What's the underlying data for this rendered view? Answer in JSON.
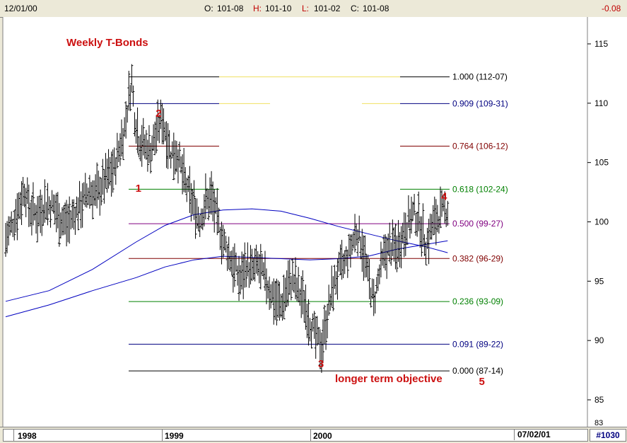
{
  "header": {
    "date": "12/01/00",
    "open_label": "O:",
    "open_value": "101-08",
    "high_label": "H:",
    "high_value": "101-10",
    "low_label": "L:",
    "low_value": "101-02",
    "close_label": "C:",
    "close_value": "101-08",
    "change": "-0.08"
  },
  "footer": {
    "years": [
      "1998",
      "1999",
      "2000"
    ],
    "end_date": "07/02/01",
    "chart_id": "#1030"
  },
  "chart_data": {
    "type": "line",
    "title": "Weekly T-Bonds",
    "ylim": [
      83,
      117
    ],
    "y_ticks": [
      115,
      110,
      105,
      100,
      95,
      90,
      85
    ],
    "y_tick_labels": [
      "115",
      "110",
      "105",
      "100",
      "95",
      "90",
      "85"
    ],
    "y_partial_label": "83",
    "fib_levels": [
      {
        "ratio": "1.000",
        "label": "(112-07)",
        "value": 112.22,
        "color": "#000000"
      },
      {
        "ratio": "0.909",
        "label": "(109-31)",
        "value": 109.97,
        "color": "#000080"
      },
      {
        "ratio": "0.764",
        "label": "(106-12)",
        "value": 106.38,
        "color": "#800000"
      },
      {
        "ratio": "0.618",
        "label": "(102-24)",
        "value": 102.75,
        "color": "#008000"
      },
      {
        "ratio": "0.500",
        "label": "(99-27)",
        "value": 99.84,
        "color": "#800080"
      },
      {
        "ratio": "0.382",
        "label": "(96-29)",
        "value": 96.91,
        "color": "#800000"
      },
      {
        "ratio": "0.236",
        "label": "(93-09)",
        "value": 93.28,
        "color": "#008000"
      },
      {
        "ratio": "0.091",
        "label": "(89-22)",
        "value": 89.69,
        "color": "#000080"
      },
      {
        "ratio": "0.000",
        "label": "(87-14)",
        "value": 87.44,
        "color": "#000000"
      }
    ],
    "wave_labels": [
      {
        "text": "1",
        "week": 92,
        "value": 102.9
      },
      {
        "text": "2",
        "week": 106,
        "value": 109.2
      },
      {
        "text": "3",
        "week": 218,
        "value": 88.1
      },
      {
        "text": "4",
        "week": 303,
        "value": 102.2
      },
      {
        "text": "5",
        "week": 329,
        "value": 86.6
      }
    ],
    "annotation": "longer term objective",
    "price_path": [
      [
        0,
        98.5
      ],
      [
        5,
        100
      ],
      [
        10,
        101.6
      ],
      [
        13,
        102.8
      ],
      [
        17,
        101
      ],
      [
        22,
        100.6
      ],
      [
        27,
        101.5
      ],
      [
        33,
        101.3
      ],
      [
        38,
        100.2
      ],
      [
        43,
        99.9
      ],
      [
        48,
        100.8
      ],
      [
        53,
        101.7
      ],
      [
        58,
        102.6
      ],
      [
        62,
        102.3
      ],
      [
        66,
        102.9
      ],
      [
        70,
        103.8
      ],
      [
        75,
        104.5
      ],
      [
        79,
        106.5
      ],
      [
        82,
        107.8
      ],
      [
        85,
        110.5
      ],
      [
        87,
        111.9
      ],
      [
        89,
        109
      ],
      [
        92,
        107
      ],
      [
        96,
        106.4
      ],
      [
        100,
        106
      ],
      [
        104,
        107.5
      ],
      [
        108,
        108.8
      ],
      [
        111,
        107.3
      ],
      [
        114,
        105.8
      ],
      [
        118,
        105.9
      ],
      [
        122,
        104
      ],
      [
        126,
        102.5
      ],
      [
        130,
        101.3
      ],
      [
        134,
        100.2
      ],
      [
        138,
        101.6
      ],
      [
        142,
        102.1
      ],
      [
        146,
        100.1
      ],
      [
        150,
        98.4
      ],
      [
        154,
        97.3
      ],
      [
        158,
        96.1
      ],
      [
        162,
        95.1
      ],
      [
        166,
        96.4
      ],
      [
        170,
        95.8
      ],
      [
        174,
        96.3
      ],
      [
        178,
        95.4
      ],
      [
        182,
        94.4
      ],
      [
        186,
        93.4
      ],
      [
        190,
        92.9
      ],
      [
        194,
        94.4
      ],
      [
        198,
        95.2
      ],
      [
        202,
        94.1
      ],
      [
        206,
        93.3
      ],
      [
        210,
        91.6
      ],
      [
        214,
        90.2
      ],
      [
        218,
        89.5
      ],
      [
        222,
        92.2
      ],
      [
        226,
        94.5
      ],
      [
        230,
        95.9
      ],
      [
        234,
        96.4
      ],
      [
        238,
        97.7
      ],
      [
        242,
        99.3
      ],
      [
        246,
        98.1
      ],
      [
        250,
        95.4
      ],
      [
        254,
        93.2
      ],
      [
        258,
        95.6
      ],
      [
        262,
        97.5
      ],
      [
        266,
        97.9
      ],
      [
        270,
        97.8
      ],
      [
        274,
        98.9
      ],
      [
        278,
        100.1
      ],
      [
        282,
        100.7
      ],
      [
        286,
        99.9
      ],
      [
        290,
        98.1
      ],
      [
        294,
        99.6
      ],
      [
        298,
        100.4
      ],
      [
        302,
        100.9
      ],
      [
        305,
        101.1
      ]
    ],
    "moving_averages": [
      {
        "name": "",
        "color": "#0000c0",
        "path": [
          [
            0,
            93.3
          ],
          [
            30,
            94.2
          ],
          [
            60,
            96
          ],
          [
            90,
            98.3
          ],
          [
            110,
            99.7
          ],
          [
            130,
            100.6
          ],
          [
            150,
            101
          ],
          [
            170,
            101.1
          ],
          [
            190,
            100.9
          ],
          [
            210,
            100.3
          ],
          [
            230,
            99.6
          ],
          [
            250,
            99
          ],
          [
            270,
            98.4
          ],
          [
            290,
            97.9
          ],
          [
            305,
            97.4
          ]
        ]
      },
      {
        "name": "",
        "color": "#0000c0",
        "path": [
          [
            0,
            92
          ],
          [
            30,
            93
          ],
          [
            60,
            94.2
          ],
          [
            90,
            95.3
          ],
          [
            110,
            96.2
          ],
          [
            130,
            96.8
          ],
          [
            150,
            97.1
          ],
          [
            170,
            97
          ],
          [
            190,
            96.9
          ],
          [
            210,
            96.8
          ],
          [
            230,
            96.9
          ],
          [
            250,
            97.1
          ],
          [
            270,
            97.7
          ],
          [
            290,
            98.1
          ],
          [
            305,
            98.4
          ]
        ]
      }
    ]
  }
}
